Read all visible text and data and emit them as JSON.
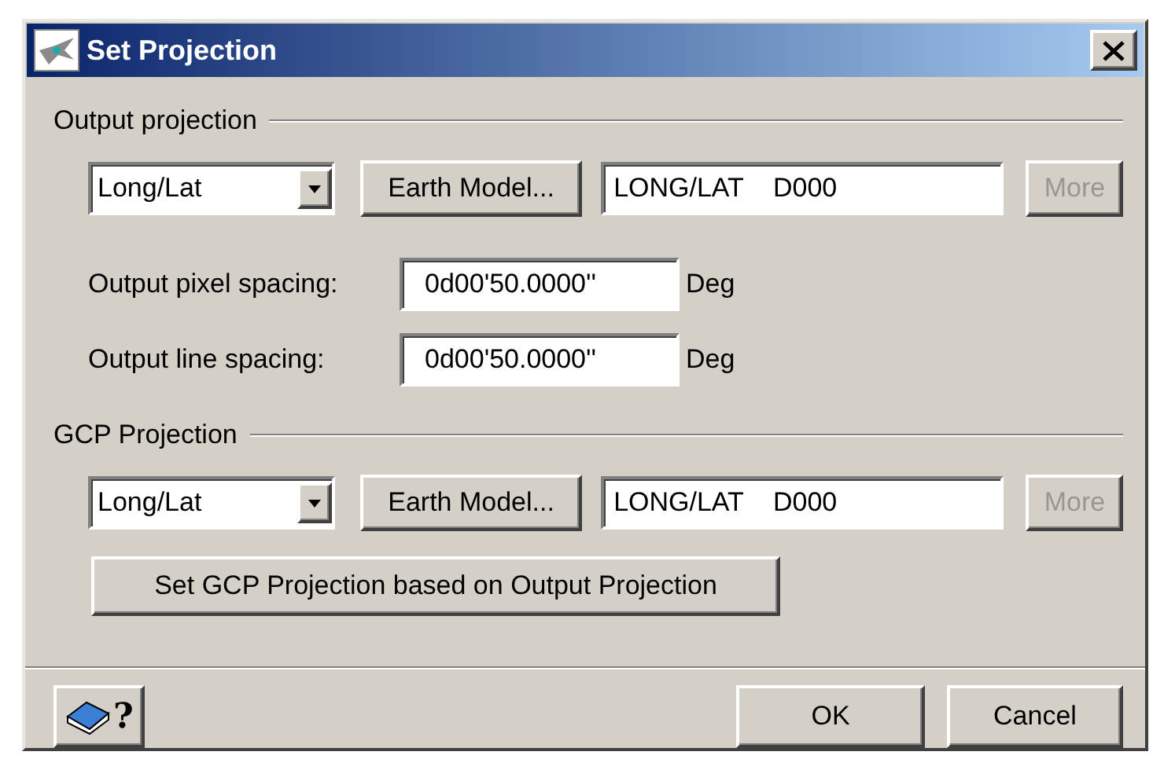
{
  "window": {
    "title": "Set Projection"
  },
  "sections": [
    {
      "title": "Output projection",
      "projection": "Long/Lat",
      "earth_model_button": "Earth Model...",
      "projection_string": "LONG/LAT    D000",
      "more_button": {
        "label": "More",
        "disabled": true
      },
      "spacings": [
        {
          "label": "Output pixel spacing:",
          "value": "0d00'50.0000''",
          "unit": "Deg"
        },
        {
          "label": "Output line spacing:",
          "value": "0d00'50.0000''",
          "unit": "Deg"
        }
      ]
    },
    {
      "title": "GCP Projection",
      "projection": "Long/Lat",
      "earth_model_button": "Earth Model...",
      "projection_string": "LONG/LAT    D000",
      "more_button": {
        "label": "More",
        "disabled": true
      },
      "action_button": "Set GCP Projection based on Output Projection"
    }
  ],
  "footer": {
    "help_mark": "?",
    "buttons": [
      "OK",
      "Cancel"
    ]
  }
}
